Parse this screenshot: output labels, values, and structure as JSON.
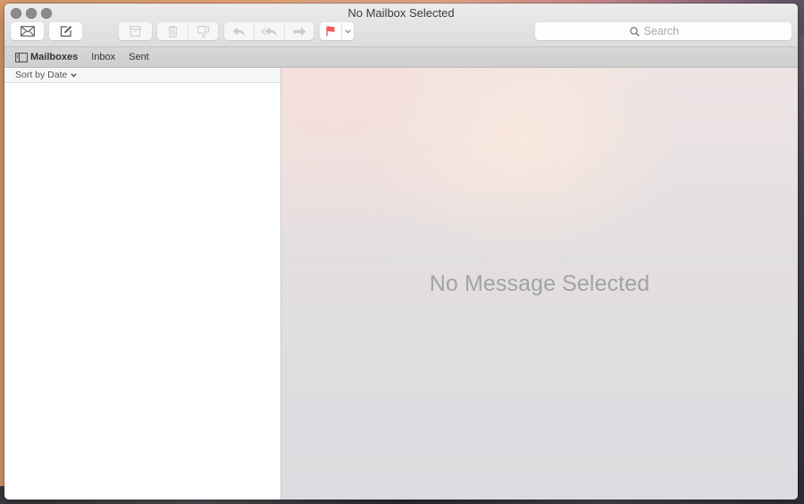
{
  "window": {
    "title": "No Mailbox Selected"
  },
  "toolbar": {
    "get_mail": {
      "icon": "envelope-icon",
      "label": "Get Mail"
    },
    "compose": {
      "icon": "compose-icon",
      "label": "New Message"
    },
    "archive": {
      "icon": "archive-icon",
      "label": "Archive"
    },
    "delete": {
      "icon": "trash-icon",
      "label": "Delete"
    },
    "junk": {
      "icon": "thumbs-down-icon",
      "label": "Junk"
    },
    "reply": {
      "icon": "reply-icon",
      "label": "Reply"
    },
    "reply_all": {
      "icon": "reply-all-icon",
      "label": "Reply All"
    },
    "forward": {
      "icon": "forward-icon",
      "label": "Forward"
    },
    "flag": {
      "icon": "flag-icon",
      "label": "Flag",
      "color": "#f25b5b"
    },
    "flag_menu": {
      "icon": "chevron-down-icon"
    }
  },
  "search": {
    "placeholder": "Search",
    "value": ""
  },
  "favorites_bar": {
    "mailboxes": "Mailboxes",
    "items": [
      "Inbox",
      "Sent"
    ]
  },
  "message_list": {
    "sort_label": "Sort by Date",
    "messages": []
  },
  "viewer": {
    "empty_text": "No Message Selected"
  }
}
